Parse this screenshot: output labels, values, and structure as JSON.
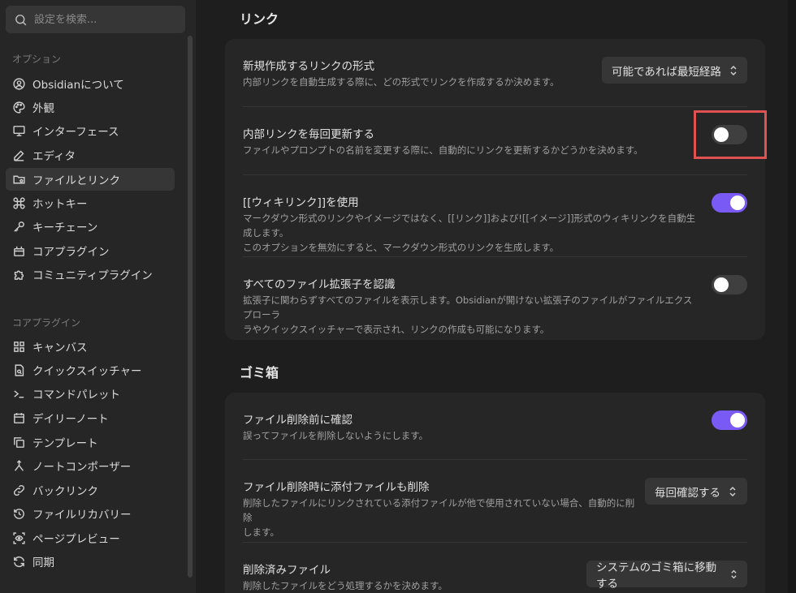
{
  "sidebar": {
    "search_placeholder": "設定を検索...",
    "options_heading": "オプション",
    "options": [
      {
        "label": "Obsidianについて",
        "icon": "info-circle-icon"
      },
      {
        "label": "外観",
        "icon": "palette-icon"
      },
      {
        "label": "インターフェース",
        "icon": "monitor-icon"
      },
      {
        "label": "エディタ",
        "icon": "pencil-icon"
      },
      {
        "label": "ファイルとリンク",
        "icon": "folder-cog-icon"
      },
      {
        "label": "ホットキー",
        "icon": "command-icon"
      },
      {
        "label": "キーチェーン",
        "icon": "key-icon"
      },
      {
        "label": "コアプラグイン",
        "icon": "plug-icon"
      },
      {
        "label": "コミュニティプラグイン",
        "icon": "puzzle-icon"
      }
    ],
    "core_heading": "コアプラグイン",
    "core": [
      {
        "label": "キャンバス",
        "icon": "grid-icon"
      },
      {
        "label": "クイックスイッチャー",
        "icon": "file-search-icon"
      },
      {
        "label": "コマンドパレット",
        "icon": "terminal-icon"
      },
      {
        "label": "デイリーノート",
        "icon": "calendar-icon"
      },
      {
        "label": "テンプレート",
        "icon": "copy-icon"
      },
      {
        "label": "ノートコンポーザー",
        "icon": "merge-icon"
      },
      {
        "label": "バックリンク",
        "icon": "link-icon"
      },
      {
        "label": "ファイルリカバリー",
        "icon": "history-icon"
      },
      {
        "label": "ページプレビュー",
        "icon": "scan-eye-icon"
      },
      {
        "label": "同期",
        "icon": "refresh-icon"
      }
    ]
  },
  "links": {
    "title": "リンク",
    "new_link_format": {
      "name": "新規作成するリンクの形式",
      "desc": "内部リンクを自動生成する際に、どの形式でリンクを作成するか決めます。",
      "value": "可能であれば最短経路"
    },
    "auto_update": {
      "name": "内部リンクを毎回更新する",
      "desc": "ファイルやプロンプトの名前を変更する際に、自動的にリンクを更新するかどうかを決めます。"
    },
    "wikilinks": {
      "name": "[[ウィキリンク]]を使用",
      "desc1": "マークダウン形式のリンクやイメージではなく、[[リンク]]および![[イメージ]]形式のウィキリンクを自動生成します。",
      "desc2": "このオプションを無効にすると、マークダウン形式のリンクを生成します。"
    },
    "all_extensions": {
      "name": "すべてのファイル拡張子を認識",
      "desc1": "拡張子に関わらずすべてのファイルを表示します。Obsidianが開けない拡張子のファイルがファイルエクスプローラ",
      "desc2": "ラやクイックスイッチャーで表示され、リンクの作成も可能になります。"
    }
  },
  "trash": {
    "title": "ゴミ箱",
    "confirm_delete": {
      "name": "ファイル削除前に確認",
      "desc": "誤ってファイルを削除しないようにします。"
    },
    "delete_attachments": {
      "name": "ファイル削除時に添付ファイルも削除",
      "desc1": "削除したファイルにリンクされている添付ファイルが他で使用されていない場合、自動的に削除",
      "desc2": "します。",
      "value": "毎回確認する"
    },
    "deleted_files": {
      "name": "削除済みファイル",
      "desc": "削除したファイルをどう処理するかを決めます。",
      "value": "システムのゴミ箱に移動する"
    }
  },
  "colors": {
    "accent": "#7a5af5",
    "highlight": "#e05252"
  }
}
